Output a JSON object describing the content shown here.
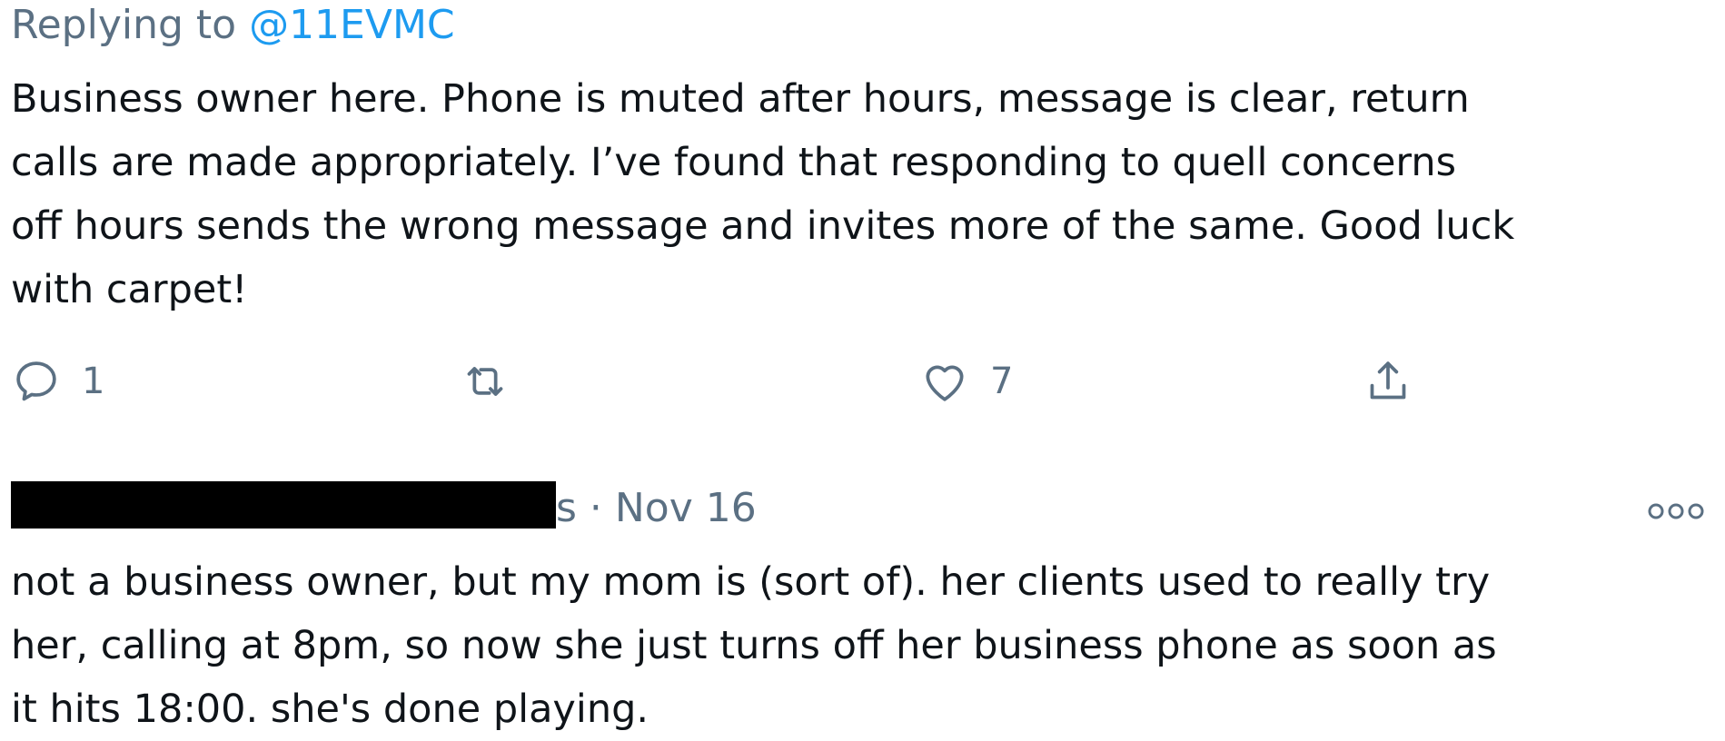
{
  "tweet1": {
    "replying_prefix": "Replying to",
    "replying_handle": "@11EVMC",
    "lines": [
      "Business owner here. Phone is muted after hours, message is clear, return",
      "calls are made appropriately. I’ve found that responding to quell concerns",
      "off hours sends the wrong message and invites more of the same. Good luck",
      "with carpet!"
    ],
    "actions": {
      "reply_icon": "reply-icon",
      "reply_count": "1",
      "retweet_icon": "retweet-icon",
      "like_icon": "heart-icon",
      "like_count": "7",
      "share_icon": "share-icon"
    }
  },
  "tweet2": {
    "name_tail": "s · Nov 16",
    "more_icon": "more-options-icon",
    "lines": [
      "not a business owner, but my mom is (sort of). her clients used to really try",
      "her, calling at 8pm, so now she just turns off her business phone as soon as",
      "it hits 18:00. she's done playing."
    ]
  },
  "colors": {
    "text": "#0f1419",
    "muted": "#5b7083",
    "link": "#1d9bf0",
    "redaction": "#000000"
  }
}
